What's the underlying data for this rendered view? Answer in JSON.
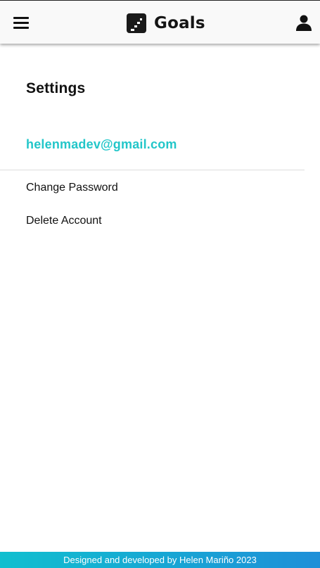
{
  "header": {
    "menu_icon": "hamburger-menu-icon",
    "brand_icon": "stairs-logo-icon",
    "title": "Goals",
    "user_icon": "user-icon"
  },
  "settings": {
    "title": "Settings",
    "email": "helenmadev@gmail.com",
    "options": [
      {
        "label": "Change Password"
      },
      {
        "label": "Delete Account"
      }
    ]
  },
  "footer": {
    "text": "Designed and developed by Helen Mariño 2023"
  },
  "colors": {
    "accent": "#22c6c9",
    "footer_gradient_start": "#10bfcf",
    "footer_gradient_end": "#1e8fd8",
    "header_bg": "#f9f9f9",
    "text": "#111111"
  }
}
